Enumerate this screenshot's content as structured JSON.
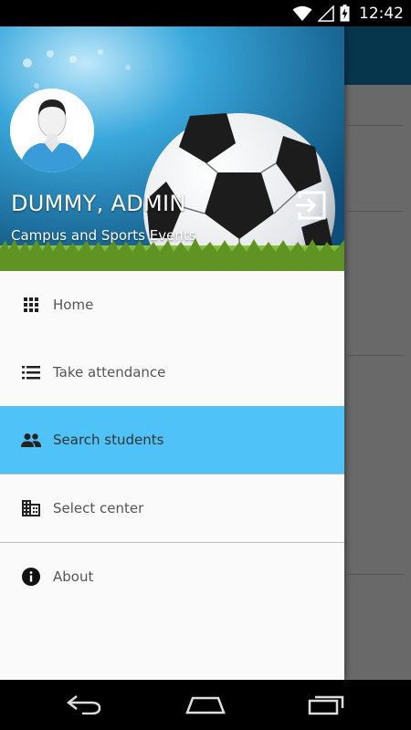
{
  "status_bar": {
    "time": "12:42"
  },
  "drawer": {
    "user_name": "DUMMY, ADMIN",
    "subtitle": "Campus and Sports Events",
    "menu": [
      {
        "label": "Home",
        "icon": "grid-icon"
      },
      {
        "label": "Take attendance",
        "icon": "list-icon"
      },
      {
        "label": "Search students",
        "icon": "people-icon",
        "active": true
      },
      {
        "label": "Select center",
        "icon": "building-icon"
      },
      {
        "label": "About",
        "icon": "info-icon"
      }
    ]
  },
  "colors": {
    "active_item": "#4fc3f7",
    "toolbar": "#0f78a8",
    "header_sky": "#3aa8dc",
    "grass": "#6fa02b"
  }
}
